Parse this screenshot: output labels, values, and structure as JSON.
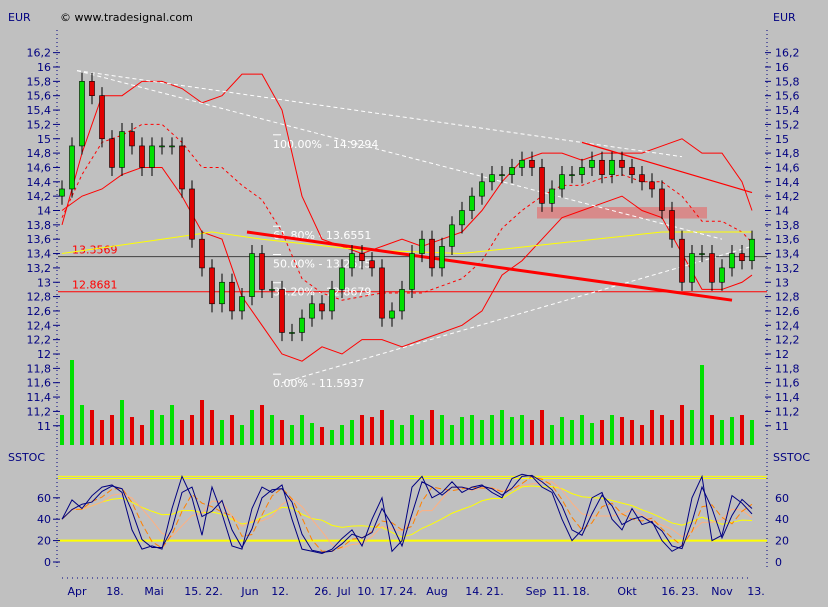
{
  "header": {
    "currency_left": "EUR",
    "currency_right": "EUR",
    "copyright": "© www.tradesignal.com",
    "indicator": "SSTOC",
    "indicator_right": "SSTOC"
  },
  "colors": {
    "bg": "#c0c0c0",
    "axis": "#000080",
    "up": "#00e000",
    "down": "#e00000",
    "band": "#ff0000",
    "ma": "#ffff00",
    "stoch": "#000080",
    "stoch_signal": "#ff8000",
    "stoch_slow": "#ffb080"
  },
  "chart_data": [
    {
      "type": "candlestick",
      "title": "Price (EUR)",
      "ylim": [
        11.0,
        16.3
      ],
      "y_ticks": [
        "16,2",
        "16",
        "15,8",
        "15,6",
        "15,4",
        "15,2",
        "15",
        "14,8",
        "14,6",
        "14,4",
        "14,2",
        "14",
        "13,8",
        "13,6",
        "13,4",
        "13,2",
        "13",
        "12,8",
        "12,6",
        "12,4",
        "12,2",
        "12",
        "11,8",
        "11,6",
        "11,4",
        "11,2",
        "11"
      ],
      "y_tick_values": [
        16.2,
        16,
        15.8,
        15.6,
        15.4,
        15.2,
        15,
        14.8,
        14.6,
        14.4,
        14.2,
        14,
        13.8,
        13.6,
        13.4,
        13.2,
        13,
        12.8,
        12.6,
        12.4,
        12.2,
        12,
        11.8,
        11.6,
        11.4,
        11.2,
        11
      ],
      "x_labels": [
        {
          "label": "Apr",
          "index": 1.5
        },
        {
          "label": "18.",
          "index": 5.3
        },
        {
          "label": "Mai",
          "index": 9.2
        },
        {
          "label": "15.",
          "index": 13.1
        },
        {
          "label": "22.",
          "index": 15.2
        },
        {
          "label": "Jun",
          "index": 18.8
        },
        {
          "label": "12.",
          "index": 21.8
        },
        {
          "label": "26.",
          "index": 26.1
        },
        {
          "label": "Jul",
          "index": 28.2
        },
        {
          "label": "10.",
          "index": 30.4
        },
        {
          "label": "17.",
          "index": 32.6
        },
        {
          "label": "24.",
          "index": 34.6
        },
        {
          "label": "Aug",
          "index": 37.5
        },
        {
          "label": "14.",
          "index": 41.2
        },
        {
          "label": "21.",
          "index": 43.3
        },
        {
          "label": "Sep",
          "index": 47.4
        },
        {
          "label": "11.",
          "index": 49.9
        },
        {
          "label": "18.",
          "index": 51.9
        },
        {
          "label": "Okt",
          "index": 56.5
        },
        {
          "label": "16.",
          "index": 60.8
        },
        {
          "label": "23.",
          "index": 62.8
        },
        {
          "label": "Nov",
          "index": 66
        },
        {
          "label": "13.",
          "index": 69.4
        }
      ],
      "closes": [
        14.3,
        14.9,
        15.8,
        15.6,
        15.0,
        14.6,
        15.1,
        14.9,
        14.6,
        14.9,
        14.9,
        14.9,
        14.3,
        13.6,
        13.2,
        12.7,
        13.0,
        12.6,
        12.8,
        13.4,
        12.9,
        12.9,
        12.3,
        12.3,
        12.5,
        12.7,
        12.6,
        12.9,
        13.2,
        13.4,
        13.3,
        13.2,
        12.5,
        12.6,
        12.9,
        13.4,
        13.6,
        13.2,
        13.5,
        13.8,
        14.0,
        14.2,
        14.4,
        14.5,
        14.5,
        14.6,
        14.7,
        14.6,
        14.1,
        14.3,
        14.5,
        14.5,
        14.6,
        14.7,
        14.5,
        14.7,
        14.6,
        14.5,
        14.4,
        14.3,
        14.0,
        13.6,
        13.0,
        13.4,
        13.4,
        13.0,
        13.2,
        13.4,
        13.3,
        13.6
      ],
      "upper_band": [
        [
          0,
          13.8
        ],
        [
          2,
          14.8
        ],
        [
          4,
          15.6
        ],
        [
          6,
          15.6
        ],
        [
          8,
          15.8
        ],
        [
          10,
          15.8
        ],
        [
          12,
          15.7
        ],
        [
          14,
          15.5
        ],
        [
          16,
          15.6
        ],
        [
          18,
          15.9
        ],
        [
          20,
          15.9
        ],
        [
          22,
          15.4
        ],
        [
          24,
          14.2
        ],
        [
          26,
          13.6
        ],
        [
          28,
          13.5
        ],
        [
          30,
          13.4
        ],
        [
          32,
          13.5
        ],
        [
          34,
          13.6
        ],
        [
          36,
          13.5
        ],
        [
          38,
          13.6
        ],
        [
          40,
          13.7
        ],
        [
          42,
          14.0
        ],
        [
          44,
          14.4
        ],
        [
          46,
          14.7
        ],
        [
          48,
          14.8
        ],
        [
          50,
          14.8
        ],
        [
          52,
          14.7
        ],
        [
          54,
          14.8
        ],
        [
          56,
          14.8
        ],
        [
          58,
          14.8
        ],
        [
          60,
          14.9
        ],
        [
          62,
          15.0
        ],
        [
          64,
          14.8
        ],
        [
          66,
          14.8
        ],
        [
          68,
          14.4
        ],
        [
          69,
          14.0
        ]
      ],
      "lower_band": [
        [
          0,
          14.0
        ],
        [
          2,
          14.2
        ],
        [
          4,
          14.3
        ],
        [
          6,
          14.5
        ],
        [
          8,
          14.6
        ],
        [
          10,
          14.6
        ],
        [
          12,
          14.2
        ],
        [
          14,
          13.7
        ],
        [
          16,
          13.6
        ],
        [
          18,
          12.8
        ],
        [
          20,
          12.4
        ],
        [
          22,
          12.0
        ],
        [
          24,
          11.9
        ],
        [
          26,
          12.1
        ],
        [
          28,
          12.0
        ],
        [
          30,
          12.2
        ],
        [
          32,
          12.2
        ],
        [
          34,
          12.1
        ],
        [
          36,
          12.2
        ],
        [
          38,
          12.3
        ],
        [
          40,
          12.4
        ],
        [
          42,
          12.6
        ],
        [
          44,
          13.1
        ],
        [
          46,
          13.3
        ],
        [
          48,
          13.6
        ],
        [
          50,
          13.9
        ],
        [
          52,
          14.0
        ],
        [
          54,
          14.1
        ],
        [
          56,
          14.2
        ],
        [
          58,
          14.0
        ],
        [
          60,
          13.9
        ],
        [
          62,
          13.4
        ],
        [
          64,
          12.9
        ],
        [
          66,
          12.9
        ],
        [
          68,
          13.0
        ],
        [
          69,
          13.1
        ]
      ],
      "moving_average": [
        [
          0,
          13.4
        ],
        [
          10,
          13.6
        ],
        [
          15,
          13.7
        ],
        [
          20,
          13.6
        ],
        [
          30,
          13.45
        ],
        [
          40,
          13.4
        ],
        [
          50,
          13.55
        ],
        [
          60,
          13.7
        ],
        [
          69,
          13.7
        ]
      ],
      "trendlines_dashed": [
        [
          [
            1.5,
            15.95
          ],
          [
            62,
            14.75
          ]
        ],
        [
          [
            1.5,
            15.95
          ],
          [
            66,
            13.6
          ]
        ],
        [
          [
            22,
            11.6
          ],
          [
            69,
            13.5
          ]
        ]
      ],
      "trendlines_red": [
        {
          "from": [
            18.5,
            13.7
          ],
          "to": [
            67,
            12.75
          ],
          "thick": true
        },
        {
          "from": [
            52,
            14.95
          ],
          "to": [
            69,
            14.25
          ],
          "thick": false
        }
      ],
      "resistance_zone": {
        "from_index": 47.5,
        "to_index": 64.5,
        "low": 13.93,
        "high": 14.02
      },
      "horizontal_lines": [
        {
          "value": 13.3569,
          "label": "13.3569",
          "color": "#404040"
        },
        {
          "value": 12.8681,
          "label": "12.8681",
          "color": "#ff0000"
        }
      ],
      "fibonacci": [
        {
          "label": "100.00% - 14.9294",
          "value": 14.9294
        },
        {
          "label": "61.80% - 13.6551",
          "value": 13.6551
        },
        {
          "label": "50.00% - 13.2615",
          "value": 13.2615
        },
        {
          "label": "38.20% - 12.8679",
          "value": 12.8679
        },
        {
          "label": "0.00% - 11.5937",
          "value": 11.5937
        }
      ],
      "volume": [
        30,
        85,
        40,
        35,
        25,
        30,
        45,
        28,
        20,
        35,
        30,
        40,
        25,
        30,
        45,
        35,
        25,
        30,
        20,
        35,
        40,
        30,
        25,
        20,
        30,
        22,
        18,
        15,
        20,
        25,
        30,
        28,
        35,
        25,
        20,
        30,
        25,
        35,
        30,
        20,
        28,
        30,
        25,
        30,
        35,
        28,
        30,
        25,
        35,
        20,
        28,
        25,
        30,
        22,
        25,
        30,
        28,
        25,
        20,
        35,
        30,
        25,
        40,
        35,
        80,
        30,
        25,
        28,
        30,
        25
      ]
    },
    {
      "type": "line",
      "title": "SSTOC",
      "ylim": [
        -10,
        90
      ],
      "y_ticks": [
        "60",
        "40",
        "20",
        "0"
      ],
      "y_tick_values": [
        60,
        40,
        20,
        0
      ],
      "levels": [
        20,
        78,
        80
      ],
      "k": [
        40,
        58,
        50,
        62,
        70,
        72,
        65,
        30,
        12,
        15,
        12,
        50,
        80,
        60,
        25,
        70,
        45,
        15,
        12,
        50,
        70,
        65,
        72,
        40,
        12,
        10,
        8,
        12,
        22,
        30,
        15,
        40,
        60,
        10,
        20,
        70,
        80,
        60,
        65,
        75,
        65,
        70,
        72,
        65,
        60,
        78,
        82,
        80,
        70,
        65,
        40,
        20,
        30,
        60,
        65,
        40,
        30,
        50,
        35,
        38,
        20,
        10,
        15,
        60,
        80,
        20,
        25,
        62,
        55,
        45
      ]
    }
  ]
}
